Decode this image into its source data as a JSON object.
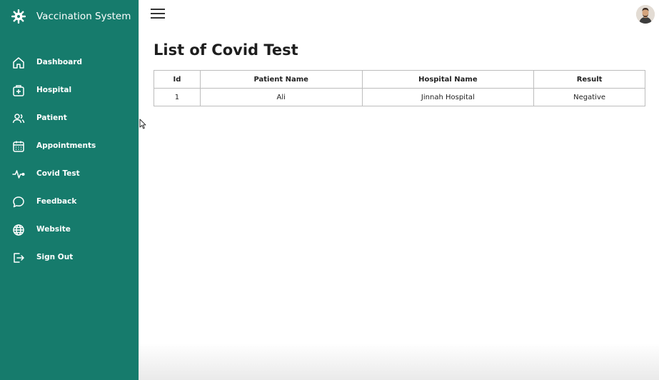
{
  "app": {
    "title": "Vaccination System",
    "brand_color": "#167b6c",
    "brand_icon": "virus-gear-icon"
  },
  "sidebar": {
    "items": [
      {
        "label": "Dashboard",
        "icon": "home-icon"
      },
      {
        "label": "Hospital",
        "icon": "medical-kit-icon"
      },
      {
        "label": "Patient",
        "icon": "users-icon"
      },
      {
        "label": "Appointments",
        "icon": "calendar-icon"
      },
      {
        "label": "Covid Test",
        "icon": "pulse-icon"
      },
      {
        "label": "Feedback",
        "icon": "chat-bubble-icon"
      },
      {
        "label": "Website",
        "icon": "globe-icon"
      },
      {
        "label": "Sign Out",
        "icon": "sign-out-icon"
      }
    ]
  },
  "topbar": {
    "menu_icon": "hamburger-icon",
    "avatar_icon": "user-avatar"
  },
  "main": {
    "title": "List of Covid Test",
    "table": {
      "headers": [
        "Id",
        "Patient Name",
        "Hospital Name",
        "Result"
      ],
      "rows": [
        [
          "1",
          "Ali",
          "Jinnah Hospital",
          "Negative"
        ]
      ]
    }
  }
}
